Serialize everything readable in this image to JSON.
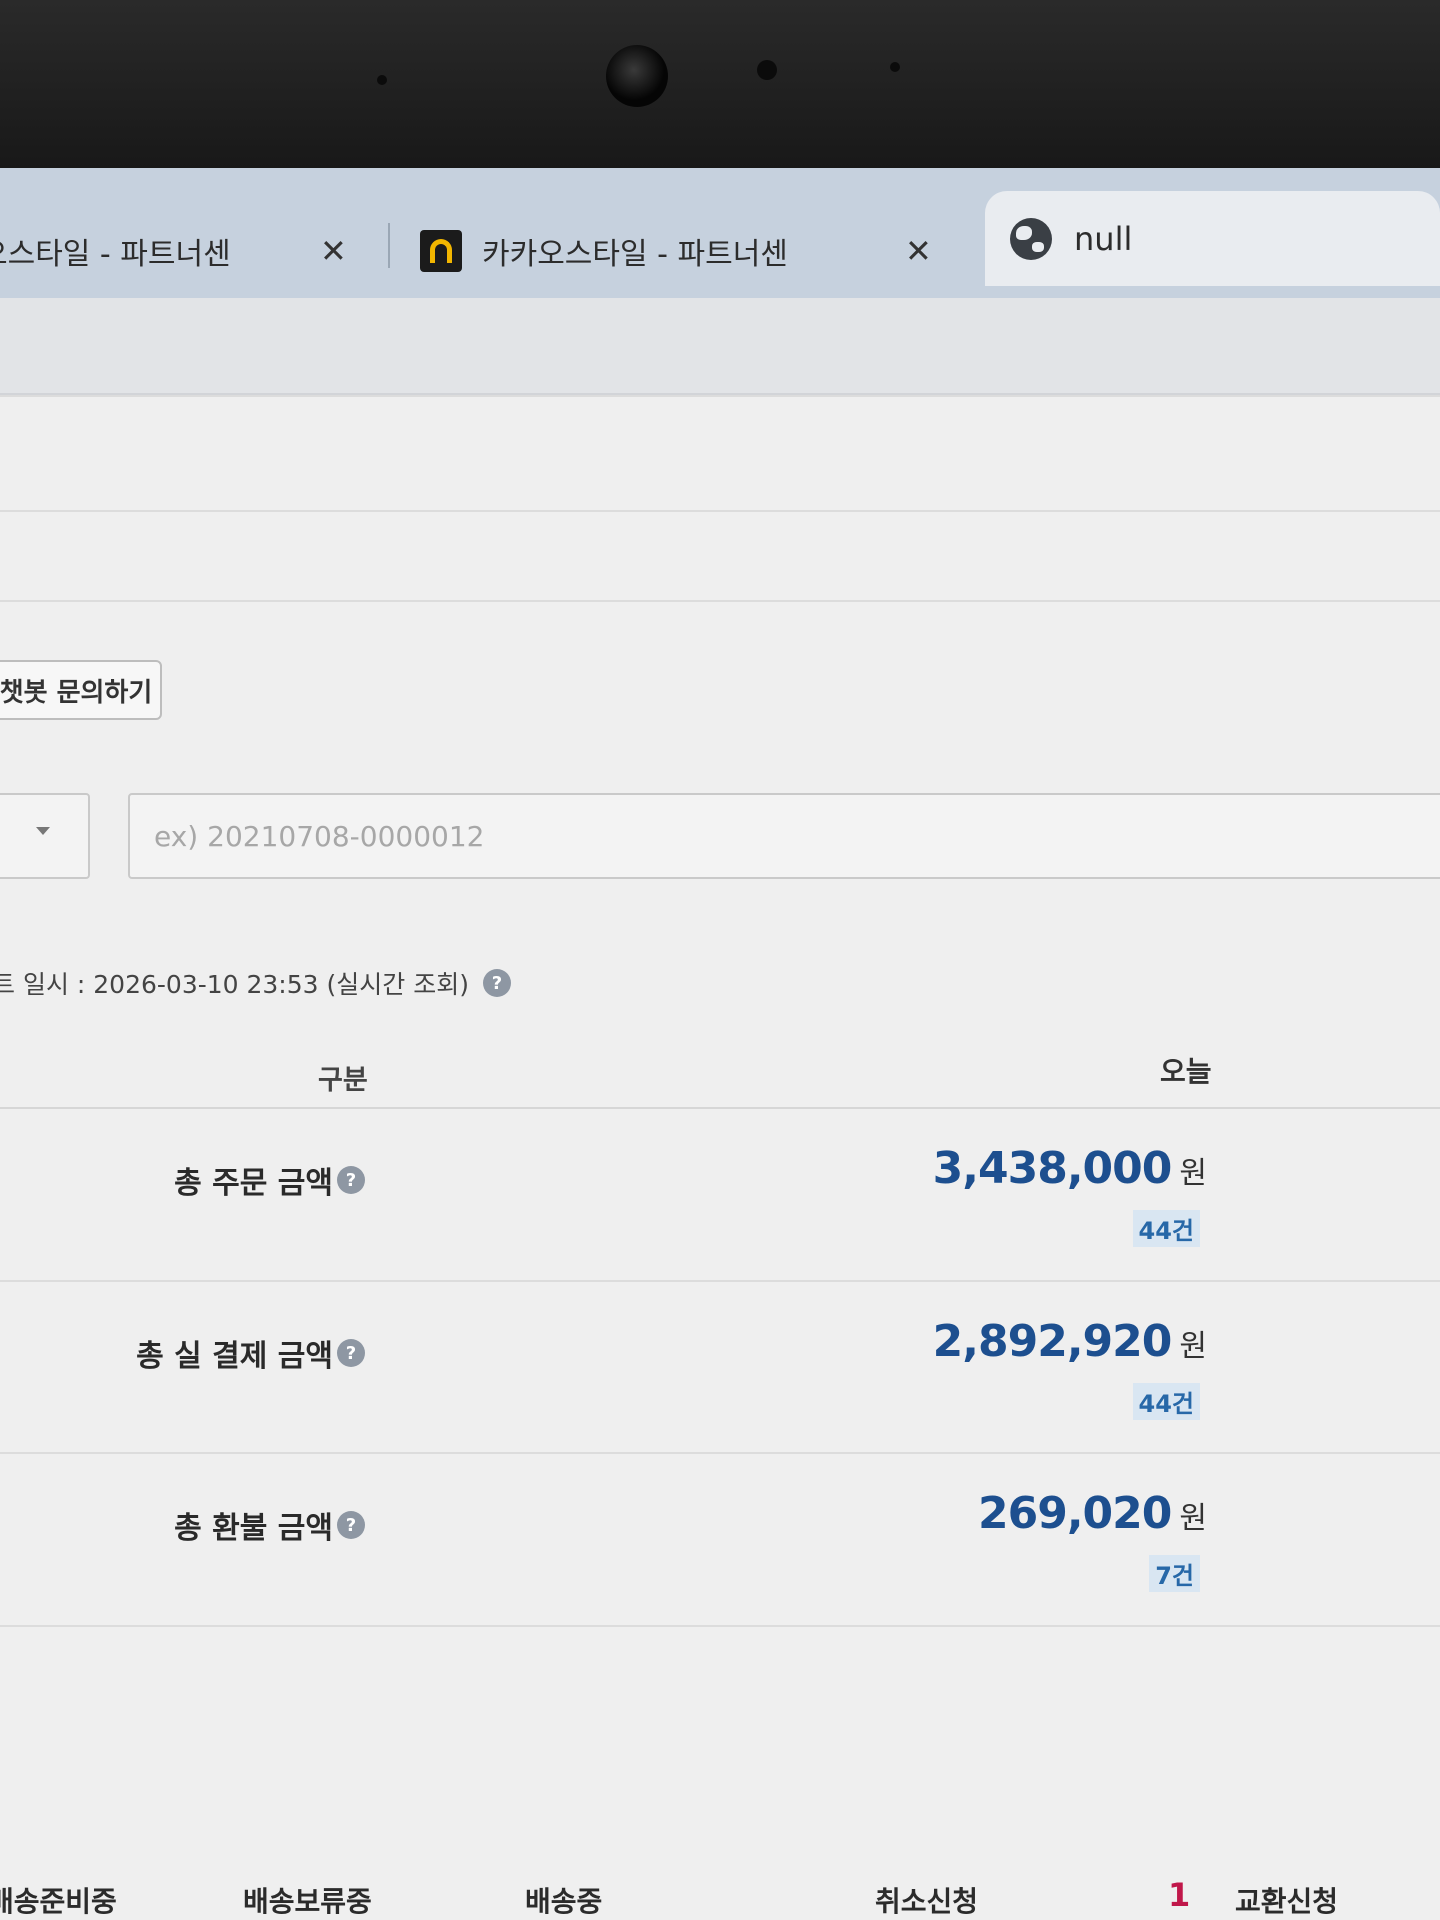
{
  "browser": {
    "tabs": [
      {
        "title": "오스타일 - 파트너센",
        "close": "✕"
      },
      {
        "title": "카카오스타일 - 파트너센",
        "close": "✕"
      },
      {
        "title": "null"
      }
    ]
  },
  "page": {
    "chatbot_button": "챗봇 문의하기",
    "search": {
      "placeholder": "ex) 20210708-0000012",
      "value": ""
    },
    "update_info": "트 일시 : 2026-03-10 23:53 (실시간 조회)",
    "help_glyph": "?",
    "summary_table": {
      "header_category": "구분",
      "header_today": "오늘",
      "rows": [
        {
          "label": "총 주문 금액",
          "amount": "3,438,000",
          "unit": "원",
          "count": "44건"
        },
        {
          "label": "총 실 결제 금액",
          "amount": "2,892,920",
          "unit": "원",
          "count": "44건"
        },
        {
          "label": "총 환불 금액",
          "amount": "269,020",
          "unit": "원",
          "count": "7건"
        }
      ]
    },
    "status_bar": {
      "items": [
        "배송준비중",
        "배송보류중",
        "배송중",
        "취소신청",
        "교환신청"
      ],
      "exchange_count": "1"
    }
  },
  "colors": {
    "amount": "#1d4f8f",
    "count": "#2768a8",
    "count_bg": "#d9e6f2",
    "status_count": "#c0174a",
    "tab_bar": "#c6d1de"
  }
}
